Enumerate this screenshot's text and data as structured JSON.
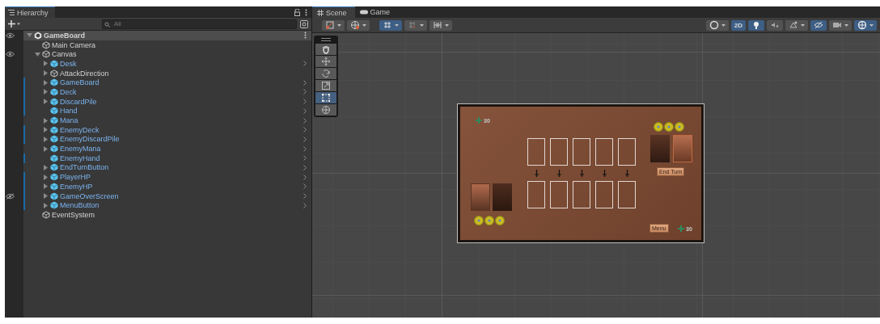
{
  "hierarchy": {
    "title": "Hierarchy",
    "search": {
      "placeholder": "All"
    },
    "items": [
      {
        "name": "GameBoard",
        "kind": "scene",
        "expandable": true,
        "expanded": true,
        "eye_shown": true,
        "hidden": false,
        "modified": false,
        "selected": true,
        "children": [
          {
            "name": "Main Camera",
            "kind": "object",
            "expandable": false,
            "expanded": false,
            "eye_shown": false,
            "hidden": false,
            "modified": false,
            "selected": false
          },
          {
            "name": "Canvas",
            "kind": "object",
            "expandable": true,
            "expanded": true,
            "eye_shown": true,
            "hidden": false,
            "modified": false,
            "selected": false,
            "children": [
              {
                "name": "Desk",
                "kind": "prefab",
                "expandable": true,
                "expanded": false,
                "eye_shown": false,
                "hidden": false,
                "modified": false,
                "selected": false
              },
              {
                "name": "AttackDirection",
                "kind": "object",
                "expandable": true,
                "expanded": false,
                "eye_shown": false,
                "hidden": false,
                "modified": false,
                "selected": false
              },
              {
                "name": "GameBoard",
                "kind": "prefab",
                "expandable": true,
                "expanded": false,
                "eye_shown": false,
                "hidden": false,
                "modified": true,
                "selected": false
              },
              {
                "name": "Deck",
                "kind": "prefab",
                "expandable": true,
                "expanded": false,
                "eye_shown": false,
                "hidden": false,
                "modified": true,
                "selected": false
              },
              {
                "name": "DiscardPile",
                "kind": "prefab",
                "expandable": true,
                "expanded": false,
                "eye_shown": false,
                "hidden": false,
                "modified": true,
                "selected": false
              },
              {
                "name": "Hand",
                "kind": "prefab",
                "expandable": false,
                "expanded": false,
                "eye_shown": false,
                "hidden": false,
                "modified": true,
                "selected": false
              },
              {
                "name": "Mana",
                "kind": "prefab",
                "expandable": true,
                "expanded": false,
                "eye_shown": false,
                "hidden": false,
                "modified": false,
                "selected": false
              },
              {
                "name": "EnemyDeck",
                "kind": "prefab",
                "expandable": true,
                "expanded": false,
                "eye_shown": false,
                "hidden": false,
                "modified": true,
                "selected": false
              },
              {
                "name": "EnemyDiscardPile",
                "kind": "prefab",
                "expandable": true,
                "expanded": false,
                "eye_shown": false,
                "hidden": false,
                "modified": true,
                "selected": false
              },
              {
                "name": "EnemyMana",
                "kind": "prefab",
                "expandable": true,
                "expanded": false,
                "eye_shown": false,
                "hidden": false,
                "modified": false,
                "selected": false
              },
              {
                "name": "EnemyHand",
                "kind": "prefab",
                "expandable": false,
                "expanded": false,
                "eye_shown": false,
                "hidden": false,
                "modified": true,
                "selected": false
              },
              {
                "name": "EndTurnButton",
                "kind": "prefab",
                "expandable": true,
                "expanded": false,
                "eye_shown": false,
                "hidden": false,
                "modified": false,
                "selected": false
              },
              {
                "name": "PlayerHP",
                "kind": "prefab",
                "expandable": true,
                "expanded": false,
                "eye_shown": false,
                "hidden": false,
                "modified": true,
                "selected": false
              },
              {
                "name": "EnemyHP",
                "kind": "prefab",
                "expandable": true,
                "expanded": false,
                "eye_shown": false,
                "hidden": false,
                "modified": true,
                "selected": false
              },
              {
                "name": "GameOverScreen",
                "kind": "prefab",
                "expandable": true,
                "expanded": false,
                "eye_shown": true,
                "hidden": true,
                "modified": true,
                "selected": false
              },
              {
                "name": "MenuButton",
                "kind": "prefab",
                "expandable": true,
                "expanded": false,
                "eye_shown": false,
                "hidden": false,
                "modified": true,
                "selected": false
              }
            ]
          },
          {
            "name": "EventSystem",
            "kind": "object",
            "expandable": false,
            "expanded": false,
            "eye_shown": false,
            "hidden": false,
            "modified": false,
            "selected": false
          }
        ]
      }
    ]
  },
  "scene": {
    "tabs": [
      {
        "label": "Scene",
        "kind": "scene",
        "selected": true
      },
      {
        "label": "Game",
        "kind": "game",
        "selected": false
      }
    ],
    "toolbar_left": [
      {
        "kind": "rect",
        "on": false
      },
      {
        "kind": "globe",
        "on": false
      },
      {
        "kind": "grid",
        "on": true
      },
      {
        "kind": "snap",
        "on": false
      },
      {
        "kind": "increment",
        "on": false
      }
    ],
    "toolbar_right": [
      {
        "kind": "shading",
        "on": false
      },
      {
        "kind": "label",
        "label": "2D",
        "on": true
      },
      {
        "kind": "light",
        "on": true
      },
      {
        "kind": "audio",
        "on": false
      },
      {
        "kind": "effects",
        "on": false
      },
      {
        "kind": "hidden",
        "on": true
      },
      {
        "kind": "camera",
        "on": false
      },
      {
        "kind": "gizmo",
        "on": true
      }
    ],
    "tools": [
      {
        "kind": "hand",
        "selected": false
      },
      {
        "kind": "move",
        "selected": false
      },
      {
        "kind": "rotate",
        "selected": false
      },
      {
        "kind": "scale",
        "selected": false
      },
      {
        "kind": "rect",
        "selected": true
      },
      {
        "kind": "transform",
        "selected": false
      }
    ],
    "game": {
      "enemy_hp": "30",
      "player_hp": "30",
      "end_turn": "End Turn",
      "menu": "Menu"
    }
  }
}
